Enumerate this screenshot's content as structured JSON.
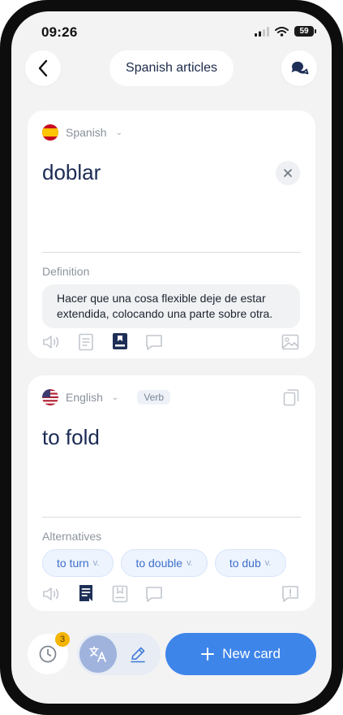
{
  "status_bar": {
    "time": "09:26",
    "battery": "59"
  },
  "header": {
    "title": "Spanish articles"
  },
  "source_card": {
    "language": "Spanish",
    "word": "doblar",
    "definition_label": "Definition",
    "definition": "Hacer que una cosa flexible deje de estar extendida, colocando una parte sobre otra."
  },
  "target_card": {
    "language": "English",
    "part_of_speech": "Verb",
    "word": "to fold",
    "alternatives_label": "Alternatives",
    "alternatives": [
      {
        "text": "to turn",
        "pos": "v."
      },
      {
        "text": "to double",
        "pos": "v."
      },
      {
        "text": "to dub",
        "pos": "v."
      }
    ]
  },
  "bottom_bar": {
    "history_badge": "3",
    "new_card_label": "New card"
  },
  "colors": {
    "accent": "#3e85ea",
    "word": "#1b2b54",
    "chip_text": "#3d6fc9",
    "badge": "#f4b400"
  }
}
